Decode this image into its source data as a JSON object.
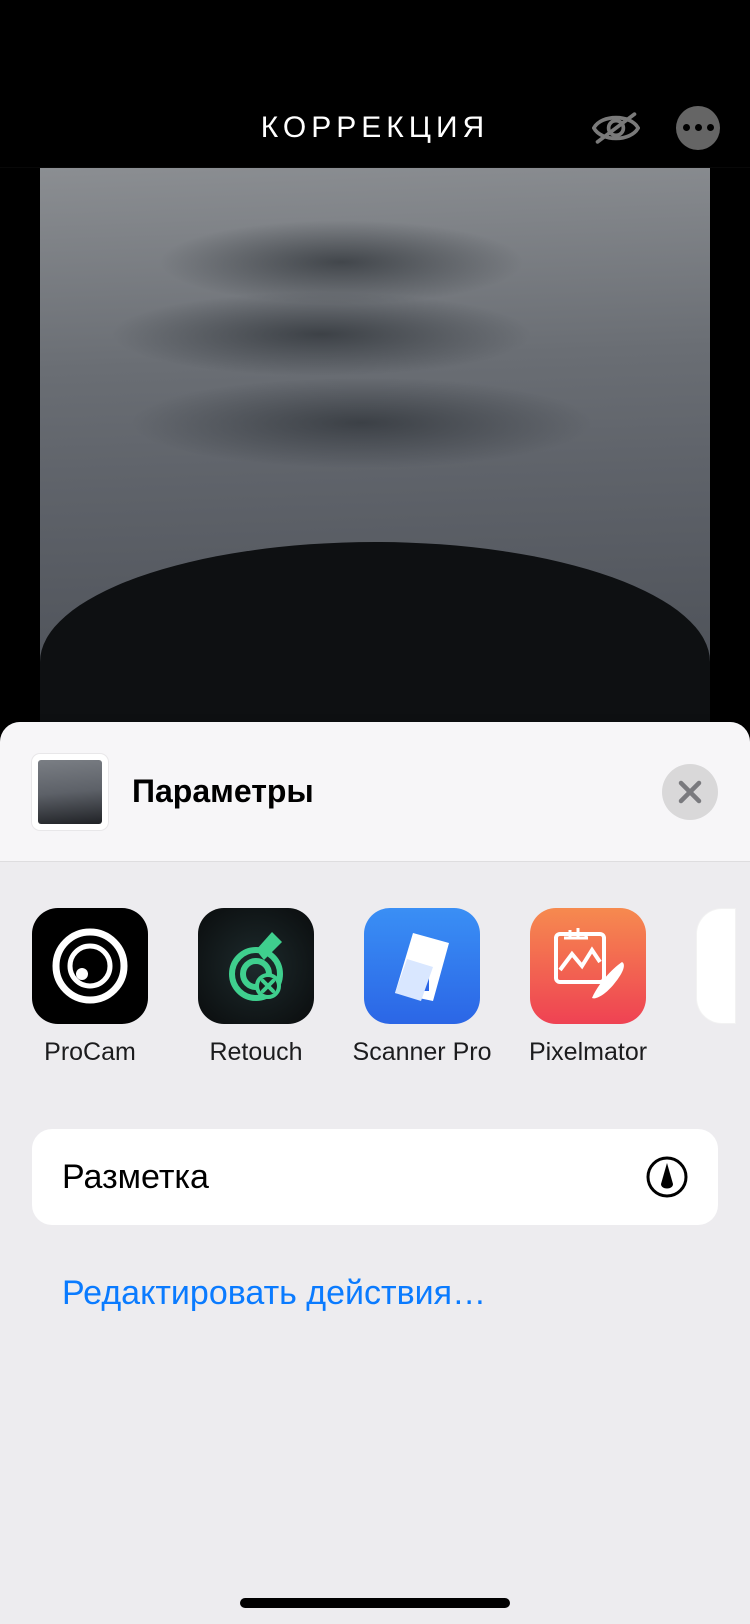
{
  "header": {
    "title": "КОРРЕКЦИЯ"
  },
  "sheet": {
    "title": "Параметры",
    "apps": [
      {
        "label": "ProCam"
      },
      {
        "label": "Retouch"
      },
      {
        "label": "Scanner Pro"
      },
      {
        "label": "Pixelmator"
      }
    ],
    "markup_label": "Разметка",
    "edit_actions_label": "Редактировать действия…"
  }
}
